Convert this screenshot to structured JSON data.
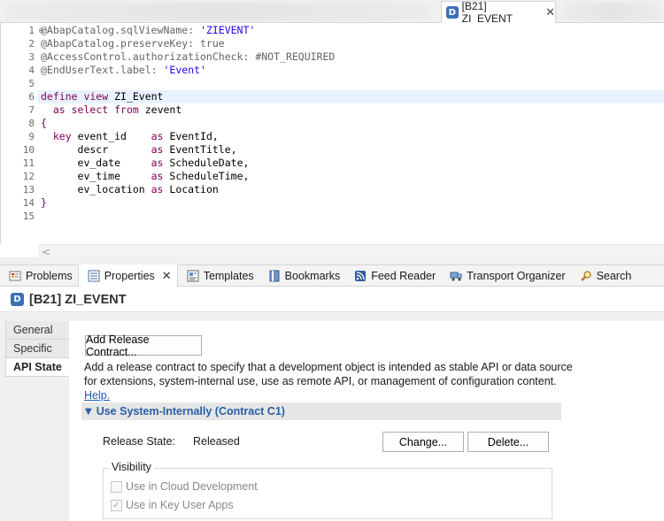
{
  "editor_tab": {
    "icon": "D",
    "title": "[B21] ZI_EVENT",
    "close": "✕"
  },
  "editor": {
    "lines": [
      {
        "n": "1",
        "fold": "⊖",
        "segments": [
          {
            "c": "ann",
            "t": "@AbapCatalog.sqlViewName: "
          },
          {
            "c": "str",
            "t": "'ZIEVENT'"
          }
        ]
      },
      {
        "n": "2",
        "segments": [
          {
            "c": "ann",
            "t": "@AbapCatalog.preserveKey: true"
          }
        ]
      },
      {
        "n": "3",
        "segments": [
          {
            "c": "ann",
            "t": "@AccessControl.authorizationCheck: #NOT_REQUIRED"
          }
        ]
      },
      {
        "n": "4",
        "segments": [
          {
            "c": "ann",
            "t": "@EndUserText.label: "
          },
          {
            "c": "str",
            "t": "'Event'"
          }
        ]
      },
      {
        "n": "5",
        "segments": []
      },
      {
        "n": "6",
        "highlight": true,
        "segments": [
          {
            "c": "kw",
            "t": "define view"
          },
          {
            "c": "pl",
            "t": " ZI_Event"
          }
        ]
      },
      {
        "n": "7",
        "segments": [
          {
            "c": "pl",
            "t": "  "
          },
          {
            "c": "kw",
            "t": "as select from"
          },
          {
            "c": "pl",
            "t": " zevent"
          }
        ]
      },
      {
        "n": "8",
        "segments": [
          {
            "c": "kw",
            "t": "{"
          }
        ]
      },
      {
        "n": "9",
        "segments": [
          {
            "c": "pl",
            "t": "  "
          },
          {
            "c": "kw",
            "t": "key"
          },
          {
            "c": "pl",
            "t": " event_id    "
          },
          {
            "c": "kw",
            "t": "as"
          },
          {
            "c": "pl",
            "t": " EventId,"
          }
        ]
      },
      {
        "n": "10",
        "segments": [
          {
            "c": "pl",
            "t": "      descr       "
          },
          {
            "c": "kw",
            "t": "as"
          },
          {
            "c": "pl",
            "t": " EventTitle,"
          }
        ]
      },
      {
        "n": "11",
        "segments": [
          {
            "c": "pl",
            "t": "      ev_date     "
          },
          {
            "c": "kw",
            "t": "as"
          },
          {
            "c": "pl",
            "t": " ScheduleDate,"
          }
        ]
      },
      {
        "n": "12",
        "segments": [
          {
            "c": "pl",
            "t": "      ev_time     "
          },
          {
            "c": "kw",
            "t": "as"
          },
          {
            "c": "pl",
            "t": " ScheduleTime,"
          }
        ]
      },
      {
        "n": "13",
        "segments": [
          {
            "c": "pl",
            "t": "      ev_location "
          },
          {
            "c": "kw",
            "t": "as"
          },
          {
            "c": "pl",
            "t": " Location"
          }
        ]
      },
      {
        "n": "14",
        "segments": [
          {
            "c": "kw",
            "t": "}"
          }
        ]
      },
      {
        "n": "15",
        "segments": []
      }
    ]
  },
  "views_bar": {
    "tabs": [
      {
        "name": "problems",
        "icon": "problems-icon",
        "label": "Problems"
      },
      {
        "name": "properties",
        "icon": "properties-icon",
        "label": "Properties",
        "active": true,
        "close": "✕"
      },
      {
        "name": "templates",
        "icon": "templates-icon",
        "label": "Templates"
      },
      {
        "name": "bookmarks",
        "icon": "bookmarks-icon",
        "label": "Bookmarks"
      },
      {
        "name": "feed-reader",
        "icon": "feed-reader-icon",
        "label": "Feed Reader"
      },
      {
        "name": "transport-organizer",
        "icon": "transport-organizer-icon",
        "label": "Transport Organizer"
      },
      {
        "name": "search",
        "icon": "search-icon",
        "label": "Search"
      }
    ]
  },
  "properties": {
    "icon": "D",
    "title": "[B21] ZI_EVENT",
    "side_tabs": [
      {
        "label": "General"
      },
      {
        "label": "Specific"
      },
      {
        "label": "API State",
        "active": true
      }
    ],
    "add_button": "Add Release Contract...",
    "description_1": "Add a release contract to specify that a development object is intended as stable API or data source",
    "description_2": "for extensions, system-internal use, use as remote API, or management of configuration content.",
    "help_link": "Help.",
    "section_title": "Use System-Internally (Contract C1)",
    "release_state_label": "Release State:",
    "release_state_value": "Released",
    "change_button": "Change...",
    "delete_button": "Delete...",
    "visibility_label": "Visibility",
    "cloud_dev_label": "Use in Cloud Development",
    "cloud_dev_checked": false,
    "key_user_label": "Use in Key User Apps",
    "key_user_checked": true
  },
  "colors": {
    "keyword": "#7f0055",
    "string": "#2a00ff",
    "annotation": "#646464",
    "section_title": "#2860a7",
    "link": "#1a5fb4",
    "d_icon_bg": "#3d6fb6"
  }
}
